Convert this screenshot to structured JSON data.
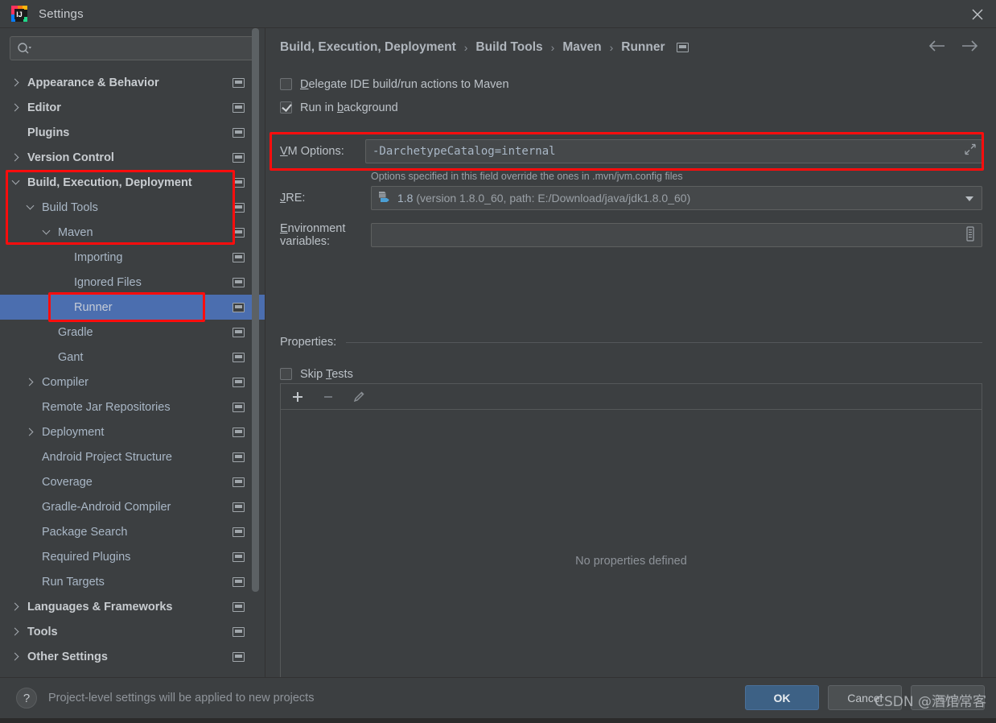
{
  "window": {
    "title": "Settings",
    "app_icon": "intellij-idea-icon",
    "close_icon": "close-icon"
  },
  "sidebar": {
    "search": {
      "placeholder": "",
      "value": "",
      "icon": "search-icon"
    },
    "items": [
      {
        "label": "Appearance & Behavior",
        "indent": 0,
        "arrow": "right",
        "bold": true,
        "selected": false,
        "highlight": false
      },
      {
        "label": "Editor",
        "indent": 0,
        "arrow": "right",
        "bold": true,
        "selected": false,
        "highlight": false
      },
      {
        "label": "Plugins",
        "indent": 0,
        "arrow": "none",
        "bold": true,
        "selected": false,
        "highlight": false
      },
      {
        "label": "Version Control",
        "indent": 0,
        "arrow": "right",
        "bold": true,
        "selected": false,
        "highlight": false
      },
      {
        "label": "Build, Execution, Deployment",
        "indent": 0,
        "arrow": "down",
        "bold": true,
        "selected": false,
        "highlight": true
      },
      {
        "label": "Build Tools",
        "indent": 1,
        "arrow": "down",
        "bold": false,
        "selected": false,
        "highlight": true
      },
      {
        "label": "Maven",
        "indent": 2,
        "arrow": "down",
        "bold": false,
        "selected": false,
        "highlight": true
      },
      {
        "label": "Importing",
        "indent": 3,
        "arrow": "none",
        "bold": false,
        "selected": false,
        "highlight": false
      },
      {
        "label": "Ignored Files",
        "indent": 3,
        "arrow": "none",
        "bold": false,
        "selected": false,
        "highlight": false
      },
      {
        "label": "Runner",
        "indent": 3,
        "arrow": "none",
        "bold": false,
        "selected": true,
        "highlight": true
      },
      {
        "label": "Gradle",
        "indent": 2,
        "arrow": "none",
        "bold": false,
        "selected": false,
        "highlight": false
      },
      {
        "label": "Gant",
        "indent": 2,
        "arrow": "none",
        "bold": false,
        "selected": false,
        "highlight": false
      },
      {
        "label": "Compiler",
        "indent": 1,
        "arrow": "right",
        "bold": false,
        "selected": false,
        "highlight": false
      },
      {
        "label": "Remote Jar Repositories",
        "indent": 1,
        "arrow": "none",
        "bold": false,
        "selected": false,
        "highlight": false
      },
      {
        "label": "Deployment",
        "indent": 1,
        "arrow": "right",
        "bold": false,
        "selected": false,
        "highlight": false
      },
      {
        "label": "Android Project Structure",
        "indent": 1,
        "arrow": "none",
        "bold": false,
        "selected": false,
        "highlight": false
      },
      {
        "label": "Coverage",
        "indent": 1,
        "arrow": "none",
        "bold": false,
        "selected": false,
        "highlight": false
      },
      {
        "label": "Gradle-Android Compiler",
        "indent": 1,
        "arrow": "none",
        "bold": false,
        "selected": false,
        "highlight": false
      },
      {
        "label": "Package Search",
        "indent": 1,
        "arrow": "none",
        "bold": false,
        "selected": false,
        "highlight": false
      },
      {
        "label": "Required Plugins",
        "indent": 1,
        "arrow": "none",
        "bold": false,
        "selected": false,
        "highlight": false
      },
      {
        "label": "Run Targets",
        "indent": 1,
        "arrow": "none",
        "bold": false,
        "selected": false,
        "highlight": false
      },
      {
        "label": "Languages & Frameworks",
        "indent": 0,
        "arrow": "right",
        "bold": true,
        "selected": false,
        "highlight": false
      },
      {
        "label": "Tools",
        "indent": 0,
        "arrow": "right",
        "bold": true,
        "selected": false,
        "highlight": false
      },
      {
        "label": "Other Settings",
        "indent": 0,
        "arrow": "right",
        "bold": true,
        "selected": false,
        "highlight": false
      }
    ]
  },
  "main": {
    "breadcrumb": [
      "Build, Execution, Deployment",
      "Build Tools",
      "Maven",
      "Runner"
    ],
    "breadcrumb_separator": "›",
    "nav_back_icon": "arrow-left-icon",
    "nav_forward_icon": "arrow-right-icon",
    "delegate_checkbox": {
      "label_pre": "",
      "mnemonic": "D",
      "label_post": "elegate IDE build/run actions to Maven",
      "checked": false
    },
    "background_checkbox": {
      "label_pre": "Run in ",
      "mnemonic": "b",
      "label_post": "ackground",
      "checked": true
    },
    "vm_options": {
      "label_pre": "",
      "mnemonic": "V",
      "label_post": "M Options:",
      "value": "-DarchetypeCatalog=internal",
      "expand_icon": "expand-icon",
      "hint": "Options specified in this field override the ones in .mvn/jvm.config files"
    },
    "jre": {
      "label_pre": "",
      "mnemonic": "J",
      "label_post": "RE:",
      "value": "1.8",
      "detail": "(version 1.8.0_60, path: E:/Download/java/jdk1.8.0_60)",
      "icon": "java-jdk-icon",
      "dropdown_icon": "chevron-down-icon"
    },
    "env_vars": {
      "label_pre": "",
      "mnemonic": "E",
      "label_post": "nvironment variables:",
      "value": "",
      "browse_icon": "list-editor-icon"
    },
    "properties": {
      "title": "Properties:",
      "skip_tests": {
        "label_pre": "Skip ",
        "mnemonic": "T",
        "label_post": "ests",
        "checked": false
      },
      "toolbar": [
        {
          "name": "add-property-button",
          "icon": "plus-icon",
          "enabled": true
        },
        {
          "name": "remove-property-button",
          "icon": "minus-icon",
          "enabled": false
        },
        {
          "name": "edit-property-button",
          "icon": "pencil-icon",
          "enabled": false
        }
      ],
      "empty_text": "No properties defined"
    }
  },
  "footer": {
    "help_icon": "question-mark-icon",
    "hint": "Project-level settings will be applied to new projects",
    "ok_label": "OK",
    "cancel_label": "Cancel",
    "apply_label": "Apply"
  },
  "watermark": "CSDN @酒馆常客",
  "colors": {
    "background": "#3c3f41",
    "selection": "#4b6eaf",
    "accent_primary": "#3d6185",
    "annotation_red": "#fd0d0d",
    "text": "#bcc2c8"
  }
}
